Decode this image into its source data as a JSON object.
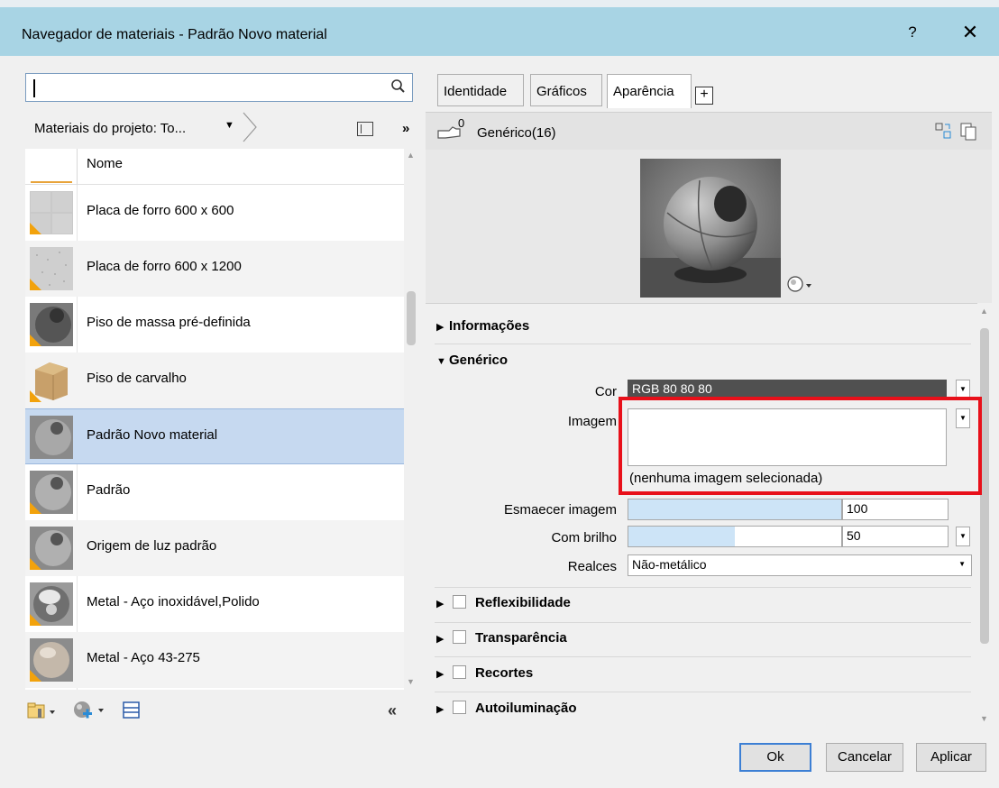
{
  "window": {
    "title": "Navegador de materiais - Padrão Novo material",
    "help": "?",
    "close": "✕"
  },
  "left": {
    "search_value": "",
    "breadcrumb": "Materiais do projeto: To...",
    "more": "»",
    "column_header": "Nome",
    "materials": [
      {
        "label": "Placa de forro 600 x 600",
        "thumb": "tile-grid"
      },
      {
        "label": "Placa de forro 600 x 1200",
        "thumb": "speckled"
      },
      {
        "label": "Piso de massa pré-definida",
        "thumb": "dark-sphere"
      },
      {
        "label": "Piso de carvalho",
        "thumb": "wood"
      },
      {
        "label": "Padrão Novo material",
        "thumb": "gray-sphere",
        "selected": true
      },
      {
        "label": "Padrão",
        "thumb": "gray-sphere"
      },
      {
        "label": "Origem de luz padrão",
        "thumb": "gray-sphere"
      },
      {
        "label": "Metal - Aço inoxidável,Polido",
        "thumb": "chrome-sphere"
      },
      {
        "label": "Metal - Aço 43-275",
        "thumb": "satin-sphere"
      }
    ],
    "collapse": "«"
  },
  "tabs": [
    {
      "label": "Identidade"
    },
    {
      "label": "Gráficos"
    },
    {
      "label": "Aparência",
      "active": true
    }
  ],
  "tab_add": "+",
  "asset": {
    "count": "0",
    "name": "Genérico(16)"
  },
  "sections": {
    "info": "Informações",
    "generic": "Genérico",
    "reflect": "Reflexibilidade",
    "transp": "Transparência",
    "cutouts": "Recortes",
    "selfillum": "Autoiluminação"
  },
  "props": {
    "color_label": "Cor",
    "color_value": "RGB 80 80 80",
    "image_label": "Imagem",
    "image_none": "(nenhuma imagem selecionada)",
    "fade_label": "Esmaecer imagem",
    "fade_value": "100",
    "fade_level": 1.0,
    "gloss_label": "Com brilho",
    "gloss_value": "50",
    "gloss_level": 0.5,
    "highlights_label": "Realces",
    "highlights_value": "Não-metálico"
  },
  "buttons": {
    "ok": "Ok",
    "cancel": "Cancelar",
    "apply": "Aplicar"
  },
  "colors": {
    "titlebar": "#a8d4e4",
    "selection": "#c6d9f0",
    "highlight_box": "#e8101a",
    "warning": "#f2a20c"
  }
}
